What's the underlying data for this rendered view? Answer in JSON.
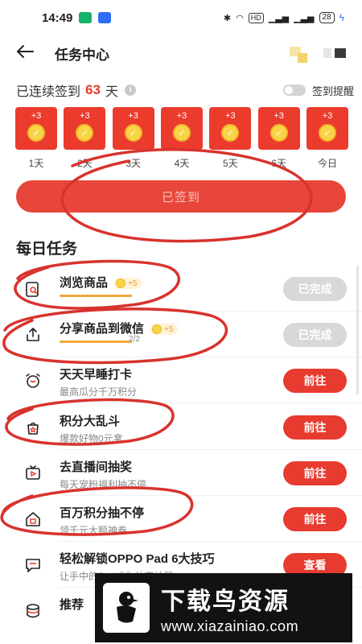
{
  "status_bar": {
    "time": "14:49",
    "network_badges": [
      "HD",
      "5G",
      "5G"
    ],
    "battery": "28"
  },
  "header": {
    "back_icon": "arrow-left-icon",
    "title": "任务中心"
  },
  "checkin": {
    "streak_prefix": "已连续签到",
    "streak_days": "63",
    "streak_suffix": "天",
    "reminder_label": "签到提醒",
    "reminder_on": false,
    "days": [
      {
        "points": "+3",
        "label": "1天"
      },
      {
        "points": "+3",
        "label": "2天"
      },
      {
        "points": "+3",
        "label": "3天"
      },
      {
        "points": "+3",
        "label": "4天"
      },
      {
        "points": "+3",
        "label": "5天"
      },
      {
        "points": "+3",
        "label": "6天"
      },
      {
        "points": "+3",
        "label": "今日"
      }
    ],
    "signed_button": "已签到"
  },
  "daily_tasks": {
    "section_title": "每日任务",
    "items": [
      {
        "icon": "search-bag-icon",
        "title": "浏览商品",
        "reward": "+5",
        "progress_text": "",
        "progress_fraction": 1.0,
        "action": "已完成"
      },
      {
        "icon": "share-icon",
        "title": "分享商品到微信",
        "reward": "+5",
        "progress_text": "2/2",
        "progress_fraction": 1.0,
        "action": "已完成"
      },
      {
        "icon": "alarm-clock-icon",
        "title": "天天早睡打卡",
        "subtitle": "最高瓜分千万积分",
        "action": "前往"
      },
      {
        "icon": "star-bag-icon",
        "title": "积分大乱斗",
        "subtitle": "爆款好物0元拿",
        "action": "前往"
      },
      {
        "icon": "live-tv-icon",
        "title": "去直播间抽奖",
        "subtitle": "每天宠粉福利抽不停",
        "action": "前往"
      },
      {
        "icon": "gift-house-icon",
        "title": "百万积分抽不停",
        "subtitle": "领千元大额神券",
        "action": "前往"
      },
      {
        "icon": "chat-bubble-icon",
        "title": "轻松解锁OPPO Pad 6大技巧",
        "subtitle": "让手中的Pad成为效率神器",
        "action": "查看"
      },
      {
        "icon": "coin-stack-icon",
        "title": "推荐"
      }
    ]
  },
  "watermark": {
    "title": "下载鸟资源",
    "url": "www.xiazainiao.com"
  },
  "colors": {
    "accent_red": "#e73b2f",
    "done_grey": "#d8d8d8",
    "coin_gold": "#f7d547",
    "annotation_red": "#d8332e"
  }
}
